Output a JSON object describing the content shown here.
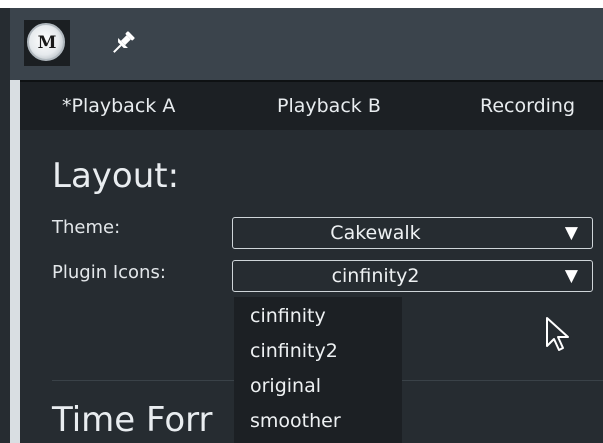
{
  "titlebar": {
    "logo_letter": "M",
    "logo_icon": "app-logo-icon",
    "pin_icon": "pin-icon"
  },
  "tabs": [
    {
      "label": "*Playback A"
    },
    {
      "label": "Playback B"
    },
    {
      "label": "Recording"
    }
  ],
  "layout_section": {
    "title": "Layout:",
    "theme": {
      "label": "Theme:",
      "value": "Cakewalk",
      "arrow": "▼"
    },
    "plugin_icons": {
      "label": "Plugin Icons:",
      "value": "cinfinity2",
      "arrow": "▼",
      "options": [
        "cinfinity",
        "cinfinity2",
        "original",
        "smoother"
      ]
    }
  },
  "time_section": {
    "title": "Time Forr"
  },
  "pointer": {
    "icon": "mouse-cursor-icon"
  },
  "colors": {
    "titlebar_bg": "#3b444c",
    "tabbar_bg": "#1c2024",
    "content_bg": "#262c31",
    "text": "#e8ecef",
    "dropdown_bg": "#1c2024"
  }
}
